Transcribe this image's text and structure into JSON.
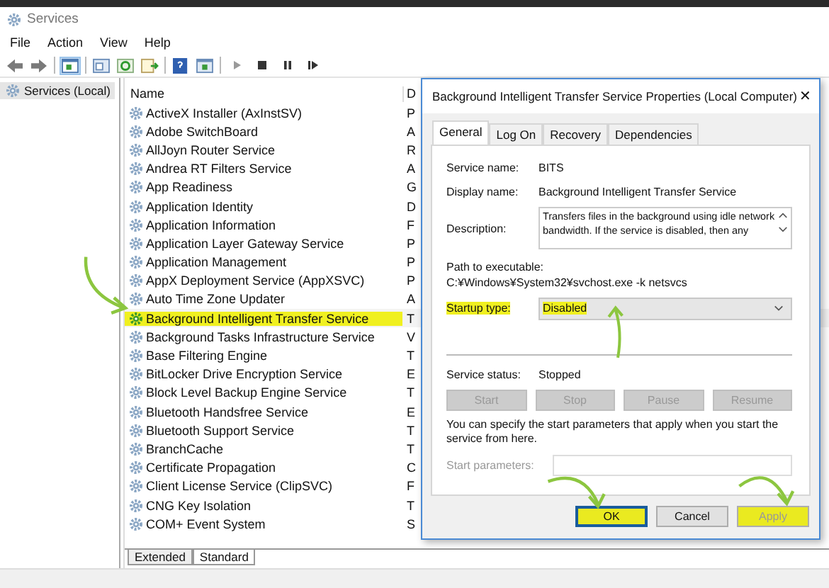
{
  "window": {
    "title": "Services"
  },
  "menu": [
    "File",
    "Action",
    "View",
    "Help"
  ],
  "tree": {
    "label": "Services (Local)",
    "selected": true
  },
  "table": {
    "columns": [
      {
        "label": "Name"
      },
      {
        "label": "D"
      }
    ],
    "rows": [
      {
        "name": "ActiveX Installer (AxInstSV)",
        "column_2": "P",
        "highlighted": false
      },
      {
        "name": "Adobe SwitchBoard",
        "column_2": "A",
        "highlighted": false
      },
      {
        "name": "AllJoyn Router Service",
        "column_2": "R",
        "highlighted": false
      },
      {
        "name": "Andrea RT Filters Service",
        "column_2": "A",
        "highlighted": false
      },
      {
        "name": "App Readiness",
        "column_2": "G",
        "highlighted": false
      },
      {
        "name": "Application Identity",
        "column_2": "D",
        "highlighted": false
      },
      {
        "name": "Application Information",
        "column_2": "F",
        "highlighted": false
      },
      {
        "name": "Application Layer Gateway Service",
        "column_2": "P",
        "highlighted": false
      },
      {
        "name": "Application Management",
        "column_2": "P",
        "highlighted": false
      },
      {
        "name": "AppX Deployment Service (AppXSVC)",
        "column_2": "P",
        "highlighted": false
      },
      {
        "name": "Auto Time Zone Updater",
        "column_2": "A",
        "highlighted": false
      },
      {
        "name": "Background Intelligent Transfer Service",
        "column_2": "T",
        "highlighted": true
      },
      {
        "name": "Background Tasks Infrastructure Service",
        "column_2": "V",
        "highlighted": false
      },
      {
        "name": "Base Filtering Engine",
        "column_2": "T",
        "highlighted": false
      },
      {
        "name": "BitLocker Drive Encryption Service",
        "column_2": "E",
        "highlighted": false
      },
      {
        "name": "Block Level Backup Engine Service",
        "column_2": "T",
        "highlighted": false
      },
      {
        "name": "Bluetooth Handsfree Service",
        "column_2": "E",
        "highlighted": false
      },
      {
        "name": "Bluetooth Support Service",
        "column_2": "T",
        "highlighted": false
      },
      {
        "name": "BranchCache",
        "column_2": "T",
        "highlighted": false
      },
      {
        "name": "Certificate Propagation",
        "column_2": "C",
        "highlighted": false
      },
      {
        "name": "Client License Service (ClipSVC)",
        "column_2": "F",
        "highlighted": false
      },
      {
        "name": "CNG Key Isolation",
        "column_2": "T",
        "highlighted": false
      },
      {
        "name": "COM+ Event System",
        "column_2": "S",
        "highlighted": false
      }
    ]
  },
  "view_tabs": [
    {
      "label": "Extended",
      "selected": false
    },
    {
      "label": "Standard",
      "selected": true
    }
  ],
  "dialog": {
    "title": "Background Intelligent Transfer Service Properties (Local Computer)",
    "close": "✕",
    "tabs": [
      {
        "label": "General",
        "selected": true
      },
      {
        "label": "Log On",
        "selected": false
      },
      {
        "label": "Recovery",
        "selected": false
      },
      {
        "label": "Dependencies",
        "selected": false
      }
    ],
    "service_name": {
      "label": "Service name:",
      "value": "BITS"
    },
    "display_name": {
      "label": "Display name:",
      "value": "Background Intelligent Transfer Service"
    },
    "description": {
      "label": "Description:",
      "value": "Transfers files in the background using idle network bandwidth. If the service is disabled, then any"
    },
    "path": {
      "label": "Path to executable:",
      "value": "C:¥Windows¥System32¥svchost.exe -k netsvcs"
    },
    "startup_type": {
      "label": "Startup type:",
      "value": "Disabled",
      "highlighted": true
    },
    "service_status": {
      "label": "Service status:",
      "value": "Stopped"
    },
    "control_buttons": [
      {
        "label": "Start",
        "disabled": true
      },
      {
        "label": "Stop",
        "disabled": true
      },
      {
        "label": "Pause",
        "disabled": true
      },
      {
        "label": "Resume",
        "disabled": true
      }
    ],
    "hint": "You can specify the start parameters that apply when you start the service from here.",
    "start_parameters": {
      "label": "Start parameters:",
      "disabled": true
    },
    "buttons": [
      {
        "label": "OK",
        "disabled": false,
        "highlighted": true
      },
      {
        "label": "Cancel",
        "disabled": false,
        "highlighted": false
      },
      {
        "label": "Apply",
        "disabled": true,
        "highlighted": true
      }
    ]
  }
}
